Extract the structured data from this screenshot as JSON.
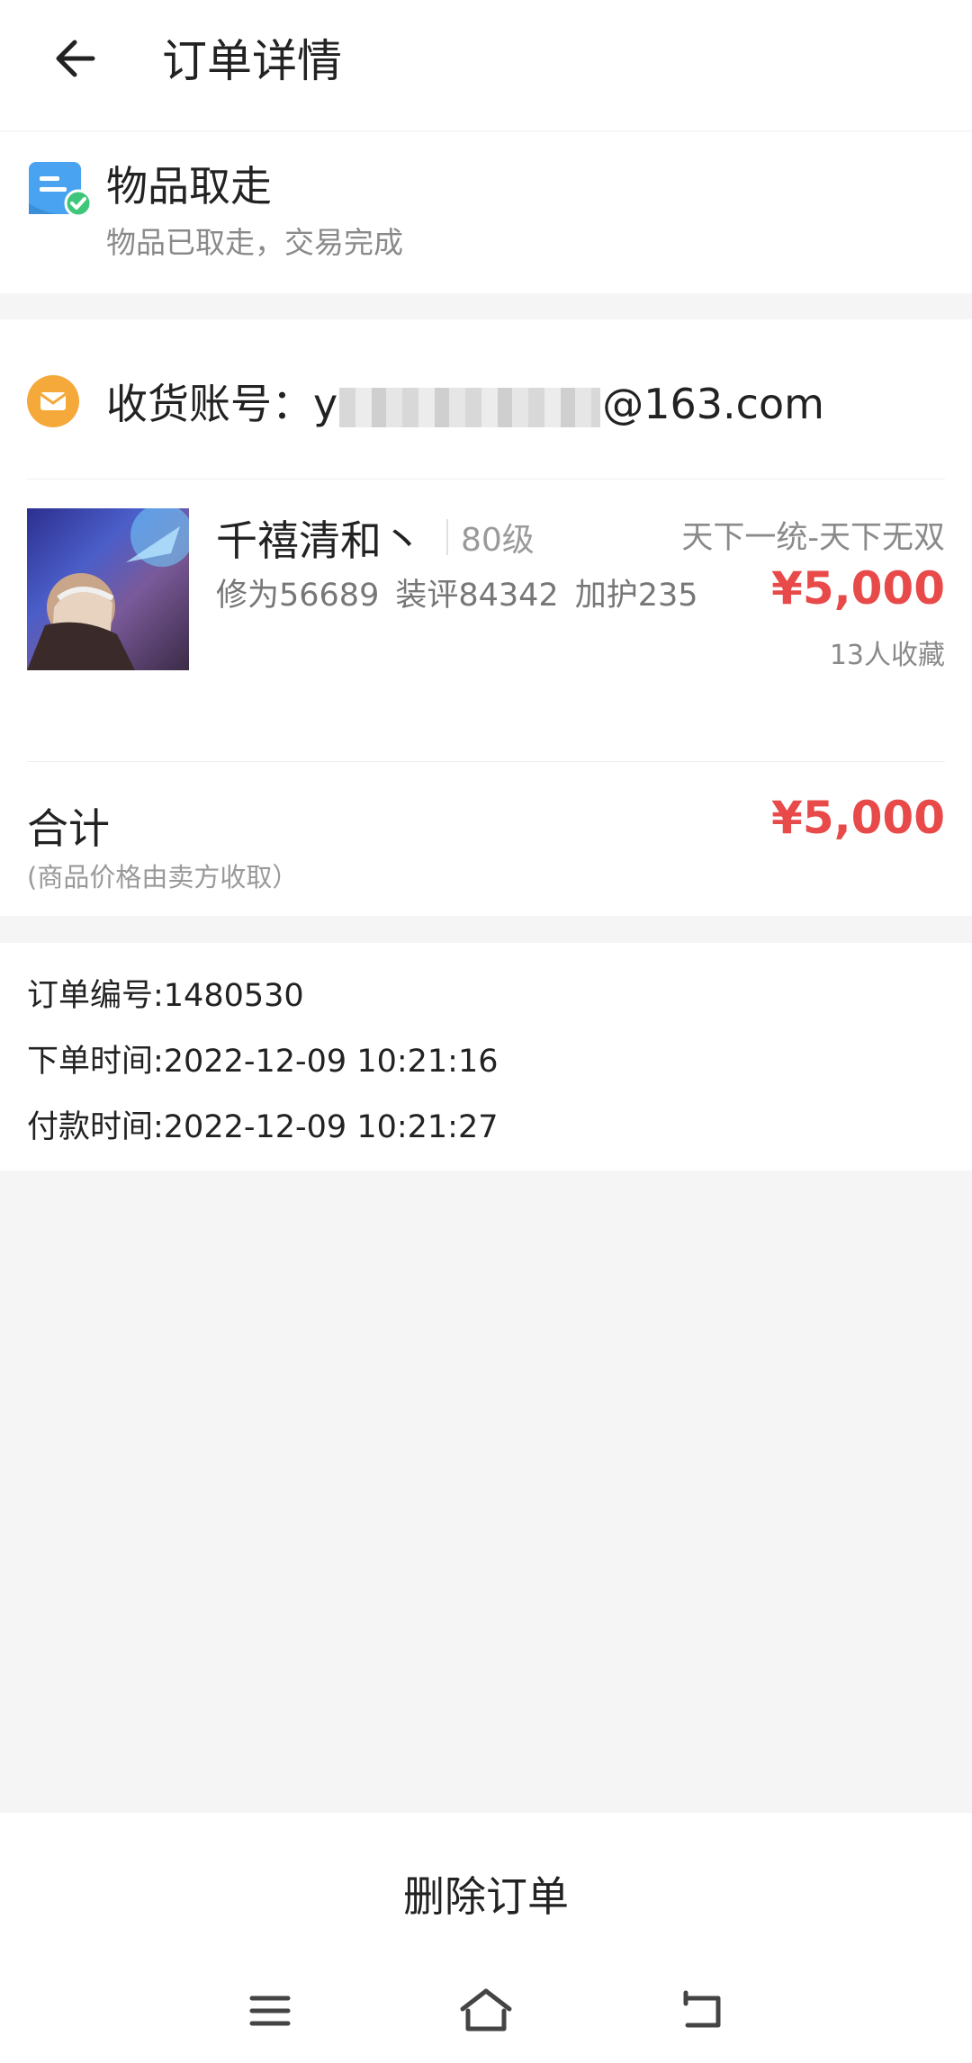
{
  "header": {
    "title": "订单详情",
    "back_icon": "arrow-left-icon"
  },
  "status": {
    "title": "物品取走",
    "subtitle": "物品已取走，交易完成",
    "icon": "order-check-icon"
  },
  "account": {
    "label_prefix": "收货账号：y",
    "label_suffix": "@163.com",
    "icon": "mail-icon"
  },
  "item": {
    "name": "千禧清和丶",
    "level": "80级",
    "server": "天下一统-天下无双",
    "stats": [
      "修为56689",
      "装评84342",
      "加护235"
    ],
    "price": "¥5,000",
    "favorites": "13人收藏"
  },
  "total": {
    "label": "合计",
    "note": "(商品价格由卖方收取）",
    "price": "¥5,000"
  },
  "order_info": [
    "订单编号:1480530",
    "下单时间:2022-12-09 10:21:16",
    "付款时间:2022-12-09 10:21:27"
  ],
  "actions": {
    "delete_label": "删除订单"
  },
  "system_nav": [
    "menu-icon",
    "home-icon",
    "back-icon"
  ],
  "colors": {
    "price": "#e84949",
    "account_icon": "#f4a93a",
    "status_icon": "#4aa3f0",
    "check": "#3ec77a"
  }
}
